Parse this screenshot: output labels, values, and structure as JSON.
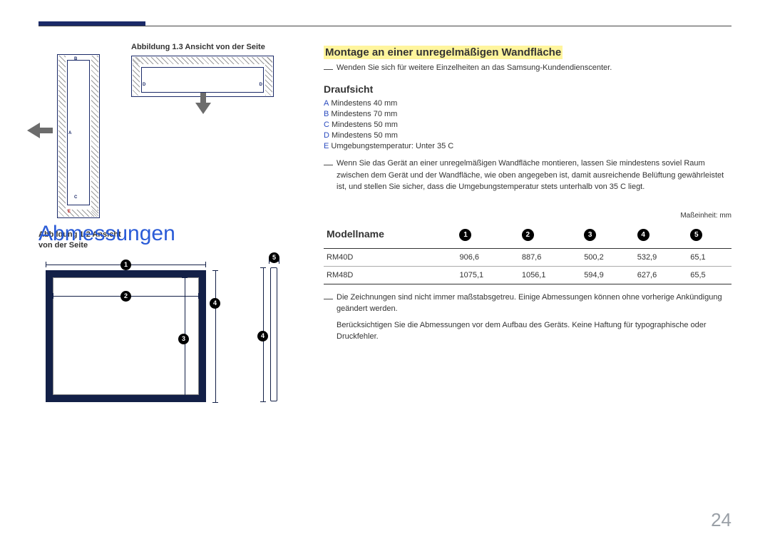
{
  "page_number": "24",
  "fig12_caption": "Abbildung 1.2 Ansicht von der Seite",
  "fig13_caption": "Abbildung 1.3 Ansicht von der Seite",
  "labels": {
    "a": "A",
    "b": "B",
    "c": "C",
    "d": "D",
    "e": "E"
  },
  "section_title": "Montage an einer unregelmäßigen Wandfläche",
  "section_note": "Wenden Sie sich für weitere Einzelheiten an das Samsung-Kundendienscenter.",
  "topview_heading": "Draufsicht",
  "specs": {
    "a": {
      "k": "A",
      "v": "Mindestens 40 mm"
    },
    "b": {
      "k": "B",
      "v": "Mindestens 70 mm"
    },
    "c": {
      "k": "C",
      "v": "Mindestens 50 mm"
    },
    "d": {
      "k": "D",
      "v": "Mindestens 50 mm"
    },
    "e": {
      "k": "E",
      "v": "Umgebungstemperatur: Unter 35 C"
    }
  },
  "mount_para": "Wenn Sie das Gerät an einer unregelmäßigen Wandfläche montieren, lassen Sie mindestens soviel Raum zwischen dem Gerät und der Wandfläche, wie oben angegeben ist, damit ausreichende Belüftung gewährleistet ist, und stellen Sie sicher, dass die Umgebungstemperatur stets unterhalb von 35 C liegt.",
  "dimensions_heading": "Abmessungen",
  "unit_label": "Maßeinheit: mm",
  "table": {
    "header": "Modellname",
    "cols": [
      "1",
      "2",
      "3",
      "4",
      "5"
    ],
    "rows": [
      {
        "model": "RM40D",
        "c1": "906,6",
        "c2": "887,6",
        "c3": "500,2",
        "c4": "532,9",
        "c5": "65,1"
      },
      {
        "model": "RM48D",
        "c1": "1075,1",
        "c2": "1056,1",
        "c3": "594,9",
        "c4": "627,6",
        "c5": "65,5"
      }
    ]
  },
  "table_note1": "Die Zeichnungen sind nicht immer maßstabsgetreu. Einige Abmessungen können ohne vorherige Ankündigung geändert werden.",
  "table_note2": "Berücksichtigen Sie die Abmessungen vor dem Aufbau des Geräts. Keine Haftung für typographische oder Druckfehler.",
  "nums": {
    "n1": "1",
    "n2": "2",
    "n3": "3",
    "n4": "4",
    "n5": "5"
  },
  "chart_data": {
    "type": "table",
    "title": "Abmessungen",
    "unit": "mm",
    "columns": [
      "Modellname",
      "1",
      "2",
      "3",
      "4",
      "5"
    ],
    "rows": [
      [
        "RM40D",
        906.6,
        887.6,
        500.2,
        532.9,
        65.1
      ],
      [
        "RM48D",
        1075.1,
        1056.1,
        594.9,
        627.6,
        65.5
      ]
    ]
  }
}
